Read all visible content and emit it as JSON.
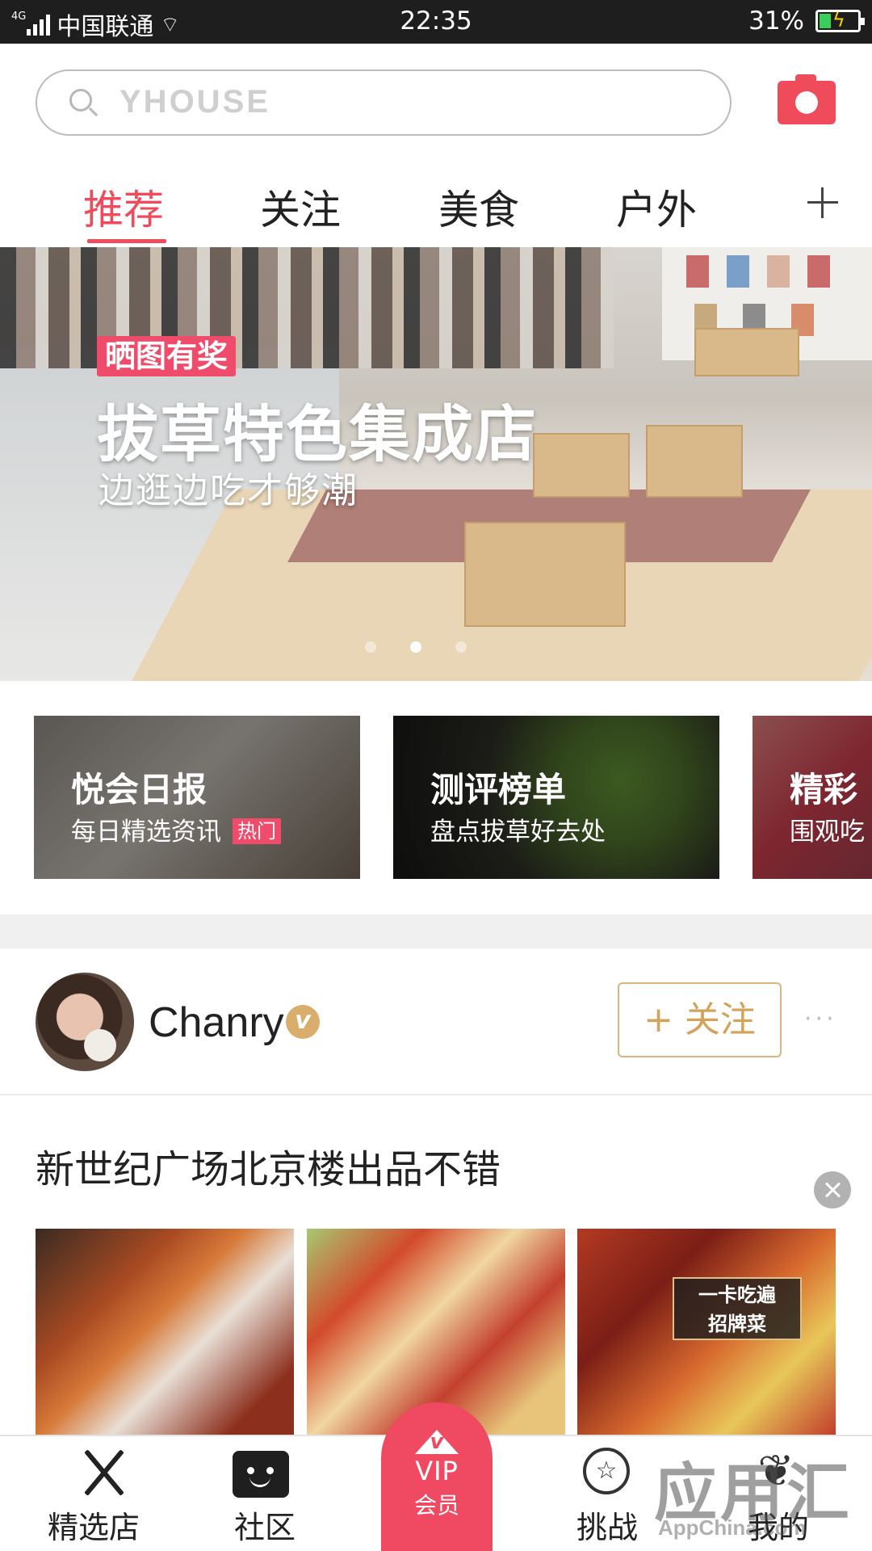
{
  "status_bar": {
    "network": "4G",
    "carrier": "中国联通",
    "time": "22:35",
    "battery": "31%",
    "battery_level": 0.31,
    "icons": [
      "signal-icon",
      "wifi-icon",
      "battery-icon"
    ]
  },
  "search": {
    "placeholder": "YHOUSE",
    "camera_icon": "camera-icon"
  },
  "tabs": [
    {
      "label": "推荐",
      "active": true
    },
    {
      "label": "关注",
      "active": false
    },
    {
      "label": "美食",
      "active": false
    },
    {
      "label": "户外",
      "active": false
    }
  ],
  "tabs_add_icon": "plus-icon",
  "banner": {
    "tag": "晒图有奖",
    "title": "拔草特色集成店",
    "subtitle": "边逛边吃才够潮",
    "slide_count": 3,
    "active_slide": 2
  },
  "cards": [
    {
      "title": "悦会日报",
      "subtitle": "每日精选资讯",
      "badge": "热门"
    },
    {
      "title": "测评榜单",
      "subtitle": "盘点拔草好去处"
    },
    {
      "title": "精彩",
      "subtitle": "围观吃"
    }
  ],
  "post": {
    "user": "Chanry",
    "verified_badge": "v",
    "follow_label": "+ 关注",
    "more_label": "···",
    "title": "新世纪广场北京楼出品不错",
    "image_tag_line1": "一卡吃遍",
    "image_tag_line2": "招牌菜"
  },
  "bottom_nav": {
    "items": [
      {
        "label": "精选店",
        "icon": "fork-knife-icon"
      },
      {
        "label": "社区",
        "icon": "tv-icon"
      },
      {
        "label": "挑战",
        "icon": "star-icon"
      },
      {
        "label": "我的",
        "icon": "antler-icon"
      }
    ],
    "vip": {
      "label": "VIP",
      "sub": "会员",
      "icon": "crown-icon"
    }
  },
  "watermark": {
    "text": "应用汇",
    "sub": "AppChina.com"
  },
  "colors": {
    "accent": "#ee4c5c",
    "gold": "#d4a35a",
    "vip": "#f04a63"
  }
}
